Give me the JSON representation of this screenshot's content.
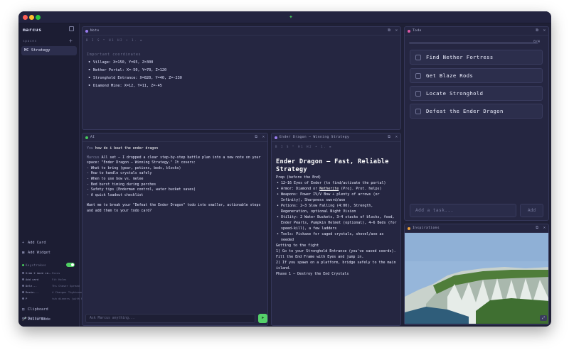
{
  "sidebar": {
    "user": "marcus",
    "spaces_label": "spaces",
    "active_space": "MC Strategy",
    "actions": [
      {
        "icon": "plus-icon",
        "label": "Add Card"
      },
      {
        "icon": "widget-icon",
        "label": "Add Widget"
      }
    ],
    "history_label": "Keystrokes",
    "history_enabled": true,
    "history": [
      {
        "label": "Grab 2 move ca...",
        "meta": "Focus"
      },
      {
        "label": "Add card",
        "meta": "Fit Holes"
      },
      {
        "label": "Dele...",
        "meta": "Ths Chaser Spread"
      },
      {
        "label": "Rezie...",
        "meta": "4 Changes Tightened"
      },
      {
        "label": "P",
        "meta": "tuh dinners (with Ranges)"
      }
    ],
    "bottom": [
      {
        "icon": "clipboard-icon",
        "label": "Clipboard"
      },
      {
        "icon": "microphone-icon",
        "label": "Voice Mode"
      },
      {
        "icon": "gear-icon",
        "label": "Settings"
      }
    ]
  },
  "note": {
    "title": "Note",
    "toolbar": "B I S ❝ H1 H2 • 1. ≡",
    "heading": "Important coordinates",
    "items": [
      "Village: X=150, Y=65, Z=300",
      "Nether Portal: X=-50, Y=70, Z=120",
      "Stronghold Entrance: X=820, Y=40, Z=-230",
      "Diamond Mine: X=12, Y=11, Z=-45"
    ]
  },
  "ai": {
    "title": "AI",
    "user_label": "You",
    "user_msg": "how do i beat the ender dragon",
    "assistant_label": "Marcus",
    "intro": "All set — I dropped a clear step-by-step battle plan into a new note on your space: \"Ender Dragon — Winning Strategy.\" It covers:",
    "bullets": [
      "- What to bring (gear, potions, beds, blocks)",
      "- How to handle crystals safely",
      "- When to use bow vs. melee",
      "- Bed burst timing during perches",
      "- Safety tips (Enderman control, water bucket saves)",
      "- A quick loadout checklist"
    ],
    "followup": "Want me to break your \"Defeat the Ender Dragon\" todo into smaller, actionable steps and add them to your todo card?",
    "input_placeholder": "Ask Marcus anything...",
    "send_icon": "send-icon"
  },
  "strategy": {
    "title": "Ender Dragon — Winning Strategy",
    "toolbar": "B I S ❝ H1 H2 • 1. ≡",
    "heading": "Ender Dragon — Fast, Reliable Strategy",
    "prep": "Prep (before the End)",
    "items": [
      {
        "text": "12–16 Eyes of Ender (to find/activate the portal)"
      },
      {
        "pre": "Armor: Diamond or ",
        "u": "Netherite",
        "post": " (Proj. Prot. helps)"
      },
      {
        "text": "Weapons: Power IV/V Bow + plenty of arrows (or Infinity), Sharpness sword/axe"
      },
      {
        "text": "Potions: 2–3 Slow Falling (4:00), Strength, Regeneration, optional Night Vision"
      },
      {
        "text": "Utility: 2 Water Buckets, 3–4 stacks of blocks, food, Ender Pearls, Pumpkin Helmet (optional), 4–6 Beds (for speed-kill), a few ladders"
      },
      {
        "text": "Tools: Pickaxe for caged crystals, shovel/axe as needed"
      }
    ],
    "getting_label": "Getting to the fight",
    "step1": "1) Go to your Stronghold Entrance (you've saved coords). Fill the End Frame with Eyes and jump in.",
    "step2": "2) If you spawn on a platform, bridge safely to the main island.",
    "phase": "Phase 1 — Destroy the End Crystals"
  },
  "todo": {
    "title": "Todo",
    "progress_text": "0/4",
    "progress_fraction": 0,
    "items": [
      "Find Nether Fortress",
      "Get Blaze Rods",
      "Locate Stronghold",
      "Defeat the Ender Dragon"
    ],
    "add_placeholder": "Add a task...",
    "add_button": "Add"
  },
  "inspirations": {
    "title": "Inspirations"
  },
  "colors": {
    "accent_green": "#55d16a",
    "note_dot": "#9a7df0",
    "ai_dot": "#46c75a",
    "strategy_dot": "#9a7df0",
    "todo_dot": "#e05aa6",
    "insp_dot": "#f0a43a"
  }
}
